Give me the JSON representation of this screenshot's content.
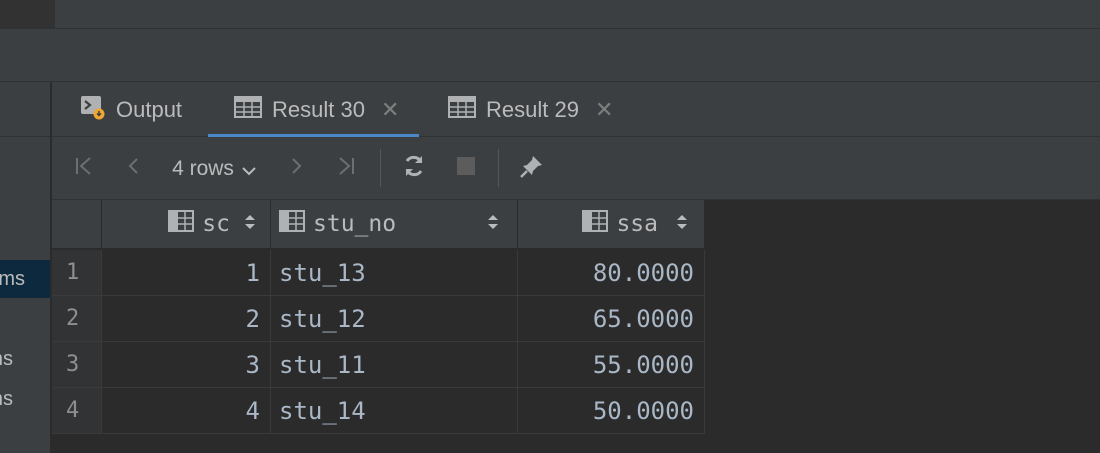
{
  "sidebar": {
    "items": [
      {
        "label": "ms",
        "selected": true
      },
      {
        "label": "ns",
        "selected": false
      },
      {
        "label": "ns",
        "selected": false
      }
    ]
  },
  "tabs": [
    {
      "label": "Output",
      "icon": "console-icon",
      "active": false,
      "closable": false
    },
    {
      "label": "Result 30",
      "icon": "table-icon",
      "active": true,
      "closable": true
    },
    {
      "label": "Result 29",
      "icon": "table-icon",
      "active": false,
      "closable": true
    }
  ],
  "toolbar": {
    "rows_label": "4 rows",
    "icons": [
      "first-page-icon",
      "previous-page-icon",
      "next-page-icon",
      "last-page-icon",
      "refresh-icon",
      "stop-icon",
      "pin-icon"
    ]
  },
  "table": {
    "columns": [
      "sc",
      "stu_no",
      "ssa"
    ],
    "rows": [
      {
        "num": "1",
        "sc": "1",
        "stu_no": "stu_13",
        "ssa": "80.0000"
      },
      {
        "num": "2",
        "sc": "2",
        "stu_no": "stu_12",
        "ssa": "65.0000"
      },
      {
        "num": "3",
        "sc": "3",
        "stu_no": "stu_11",
        "ssa": "55.0000"
      },
      {
        "num": "4",
        "sc": "4",
        "stu_no": "stu_14",
        "ssa": "50.0000"
      }
    ]
  },
  "colors": {
    "background": "#2b2b2b",
    "panel": "#3c3f41",
    "accent": "#4a88c7",
    "selection": "#0d293e",
    "cell_text": "#a9b7c6"
  }
}
